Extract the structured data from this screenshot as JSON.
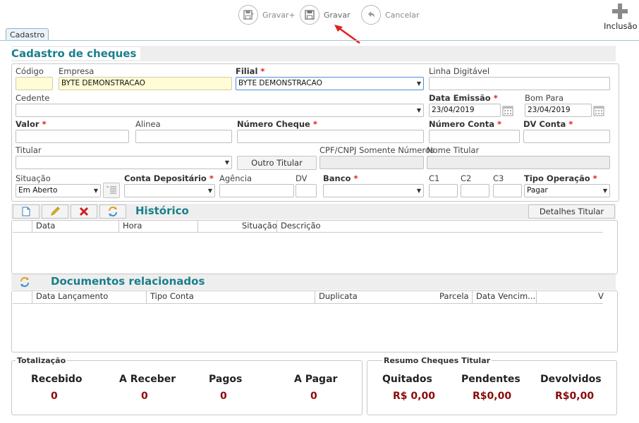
{
  "toolbar": {
    "gravar_mais": "Gravar+",
    "gravar": "Gravar",
    "cancelar": "Cancelar",
    "inclusao": "Inclusão"
  },
  "tab": "Cadastro",
  "form": {
    "title": "Cadastro de cheques",
    "codigo_label": "Código",
    "empresa_label": "Empresa",
    "empresa_value": "BYTE DEMONSTRACAO",
    "filial_label": "Filial",
    "filial_value": "BYTE DEMONSTRACAO",
    "linha_label": "Linha Digitável",
    "cedente_label": "Cedente",
    "data_emissao_label": "Data Emissão",
    "data_emissao_value": "23/04/2019",
    "bom_para_label": "Bom Para",
    "bom_para_value": "23/04/2019",
    "valor_label": "Valor",
    "alinea_label": "Alinea",
    "numero_cheque_label": "Número Cheque",
    "numero_conta_label": "Número Conta",
    "dv_conta_label": "DV Conta",
    "titular_label": "Titular",
    "outro_titular": "Outro Titular",
    "cpf_label": "CPF/CNPJ Somente Números",
    "nome_titular_label": "Nome Titular",
    "situacao_label": "Situação",
    "situacao_value": "Em Aberto",
    "conta_dep_label": "Conta Depositário",
    "agencia_label": "Agência",
    "dv_label": "DV",
    "banco_label": "Banco",
    "c1_label": "C1",
    "c2_label": "C2",
    "c3_label": "C3",
    "tipo_op_label": "Tipo Operação",
    "tipo_op_value": "Pagar",
    "required_mark": "*"
  },
  "historico": {
    "title": "Histórico",
    "detalhes": "Detalhes Titular",
    "columns": [
      "Data",
      "Hora",
      "Situação",
      "Descrição"
    ]
  },
  "documentos": {
    "title": "Documentos relacionados",
    "columns": [
      "Data Lançamento",
      "Tipo Conta",
      "Duplicata",
      "Parcela",
      "Data Vencim...",
      "V"
    ]
  },
  "totalizacao": {
    "legend": "Totalização",
    "items": [
      {
        "label": "Recebido",
        "value": "0"
      },
      {
        "label": "A Receber",
        "value": "0"
      },
      {
        "label": "Pagos",
        "value": "0"
      },
      {
        "label": "A Pagar",
        "value": "0"
      }
    ]
  },
  "resumo": {
    "legend": "Resumo Cheques Titular",
    "items": [
      {
        "label": "Quitados",
        "value": "R$ 0,00"
      },
      {
        "label": "Pendentes",
        "value": "R$0,00"
      },
      {
        "label": "Devolvidos",
        "value": "R$0,00"
      }
    ]
  },
  "colors": {
    "accent": "#1a7f8a",
    "required": "#dd2222",
    "money": "#8b0a0a"
  }
}
